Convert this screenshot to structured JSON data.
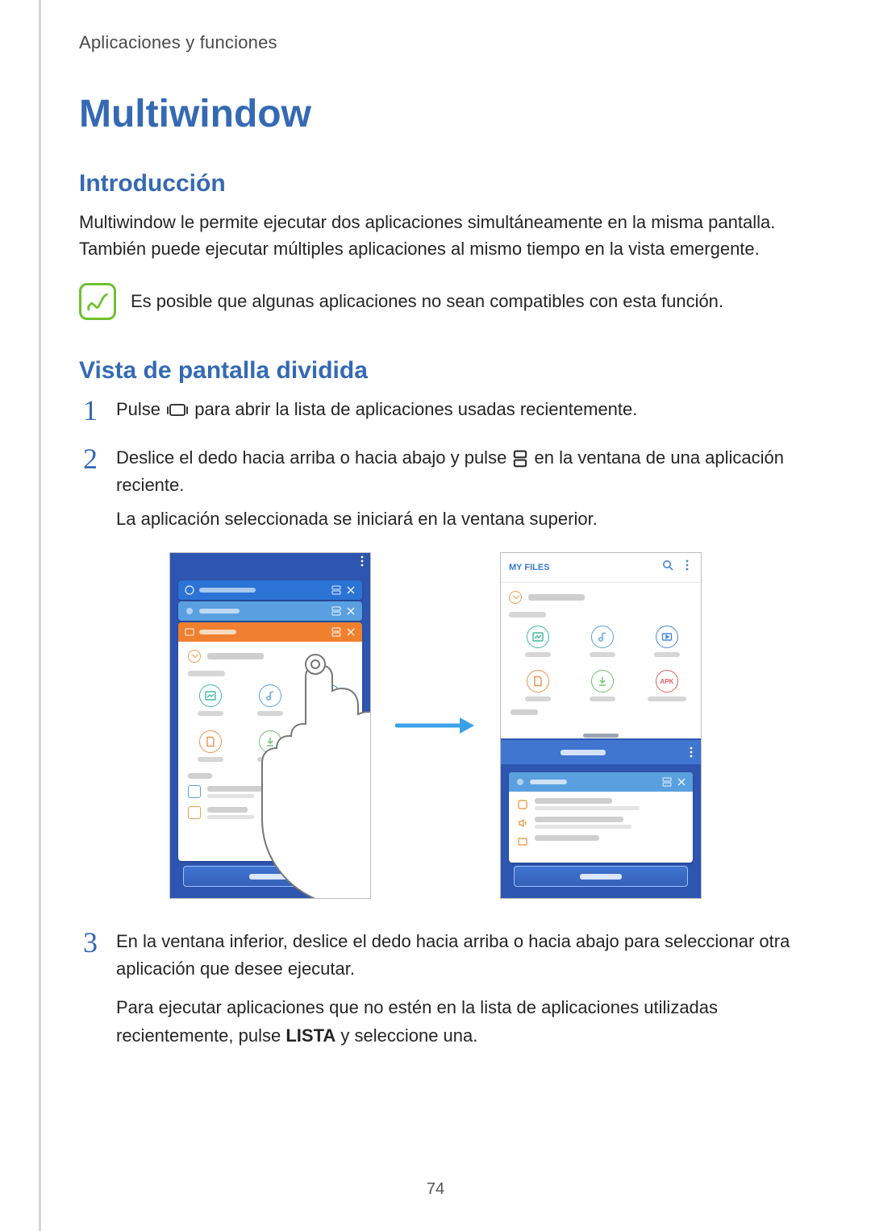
{
  "breadcrumb": "Aplicaciones y funciones",
  "title": "Multiwindow",
  "section_intro_heading": "Introducción",
  "intro_paragraph": "Multiwindow le permite ejecutar dos aplicaciones simultáneamente en la misma pantalla. También puede ejecutar múltiples aplicaciones al mismo tiempo en la vista emergente.",
  "note_text": "Es posible que algunas aplicaciones no sean compatibles con esta función.",
  "section_splitview_heading": "Vista de pantalla dividida",
  "steps": {
    "s1": {
      "num": "1",
      "before_icon": "Pulse ",
      "after_icon": " para abrir la lista de aplicaciones usadas recientemente."
    },
    "s2": {
      "num": "2",
      "before_icon": "Deslice el dedo hacia arriba o hacia abajo y pulse ",
      "after_icon": " en la ventana de una aplicación reciente.",
      "line2": "La aplicación seleccionada se iniciará en la ventana superior."
    },
    "s3": {
      "num": "3",
      "line1": "En la ventana inferior, deslice el dedo hacia arriba o hacia abajo para seleccionar otra aplicación que desee ejecutar.",
      "line2_before": "Para ejecutar aplicaciones que no estén en la lista de aplicaciones utilizadas recientemente, pulse ",
      "line2_bold": "LISTA",
      "line2_after": " y seleccione una."
    }
  },
  "figure": {
    "right_title": "MY FILES",
    "apk_label": "APK"
  },
  "page_number": "74"
}
